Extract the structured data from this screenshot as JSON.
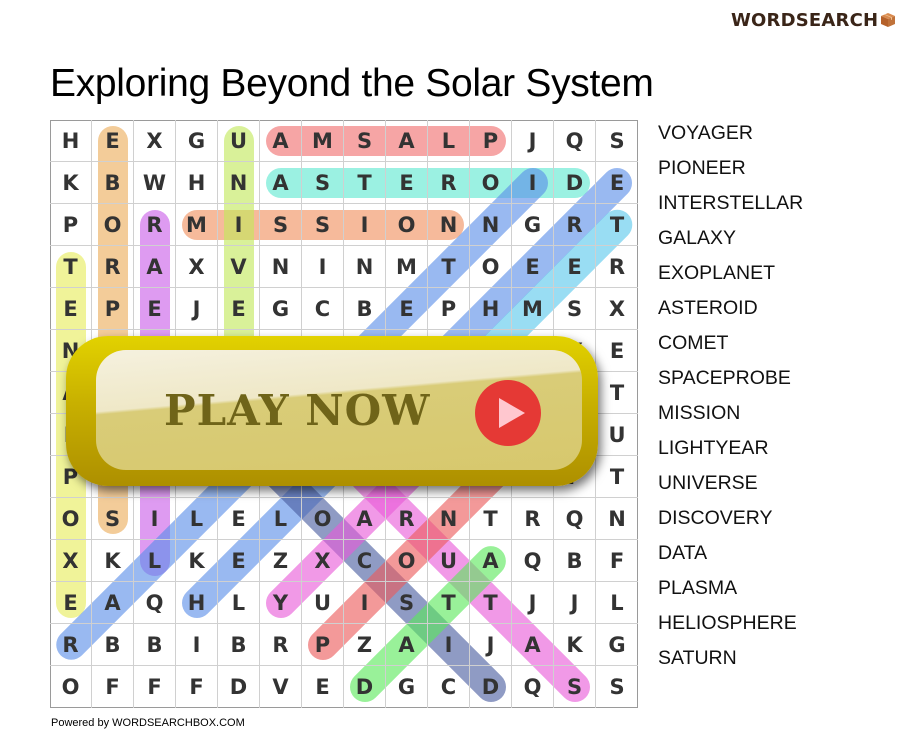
{
  "brand": {
    "name": "WORDSEARCH",
    "icon": "box-icon",
    "icon_color": "#c0723a"
  },
  "title": "Exploring Beyond the Solar System",
  "grid": {
    "rows": [
      "HEXGUAMSALPJQS",
      "KBWHNASTEROIDE",
      "PORMISSIONNGRT",
      "TRAXVNINMTOEER",
      "EPEJEGCBEPHMSX",
      "NEYDRKARPORAYE",
      "ACTRSWSCSCGRRT",
      "LAHETEONAEEEOU",
      "PPGVEVINLOEZFT",
      "OSILELOARNTRQN",
      "XKLKEZXCOUAQBF",
      "EAQHLYUISTTJJL",
      "RBBIBRPZAIJAKG",
      "OFFFDVEDGCDQSS"
    ]
  },
  "found_words": [
    {
      "word": "PLASMA",
      "color": "#f06e6e",
      "from": [
        0,
        10
      ],
      "to": [
        0,
        5
      ]
    },
    {
      "word": "ASTEROID",
      "color": "#5ee8d0",
      "from": [
        1,
        5
      ],
      "to": [
        1,
        12
      ]
    },
    {
      "word": "MISSION",
      "color": "#f0905e",
      "from": [
        2,
        3
      ],
      "to": [
        2,
        9
      ]
    },
    {
      "word": "SPACEPROBE",
      "color": "#ecac5a",
      "from": [
        9,
        1
      ],
      "to": [
        0,
        1
      ]
    },
    {
      "word": "UNIVERSE",
      "color": "#c2e85a",
      "from": [
        0,
        4
      ],
      "to": [
        7,
        4
      ]
    },
    {
      "word": "LIGHTYEAR",
      "color": "#c95ee8",
      "from": [
        10,
        2
      ],
      "to": [
        2,
        2
      ]
    },
    {
      "word": "EXOPLANET",
      "color": "#e6ec5a",
      "from": [
        11,
        0
      ],
      "to": [
        3,
        0
      ]
    },
    {
      "word": "INTERSTELLAR",
      "color": "#5a8ee8",
      "from": [
        1,
        11
      ],
      "to": [
        12,
        0
      ]
    },
    {
      "word": "HELIOSPHERE",
      "color": "#5a8ee8",
      "from": [
        11,
        3
      ],
      "to": [
        1,
        13
      ]
    },
    {
      "word": "COMET",
      "color": "#5ac8ec",
      "from": [
        6,
        9
      ],
      "to": [
        2,
        13
      ]
    },
    {
      "word": "DISCOVERY",
      "color": "#4a5ea0",
      "from": [
        13,
        10
      ],
      "to": [
        5,
        2
      ]
    },
    {
      "word": "GALAXY",
      "color": "#e85ad8",
      "from": [
        6,
        10
      ],
      "to": [
        11,
        5
      ]
    },
    {
      "word": "SATURN",
      "color": "#e85ad8",
      "from": [
        13,
        12
      ],
      "to": [
        8,
        7
      ]
    },
    {
      "word": "PIONEER",
      "color": "#ec5a5a",
      "from": [
        12,
        6
      ],
      "to": [
        6,
        12
      ]
    },
    {
      "word": "DATA",
      "color": "#5ae85a",
      "from": [
        13,
        7
      ],
      "to": [
        10,
        10
      ]
    }
  ],
  "play_button": {
    "label": "PLAY NOW",
    "icon": "play-icon"
  },
  "word_list": [
    "VOYAGER",
    "PIONEER",
    "INTERSTELLAR",
    "GALAXY",
    "EXOPLANET",
    "ASTEROID",
    "COMET",
    "SPACEPROBE",
    "MISSION",
    "LIGHTYEAR",
    "UNIVERSE",
    "DISCOVERY",
    "DATA",
    "PLASMA",
    "HELIOSPHERE",
    "SATURN"
  ],
  "footer": "Powered by WORDSEARCHBOX.COM"
}
